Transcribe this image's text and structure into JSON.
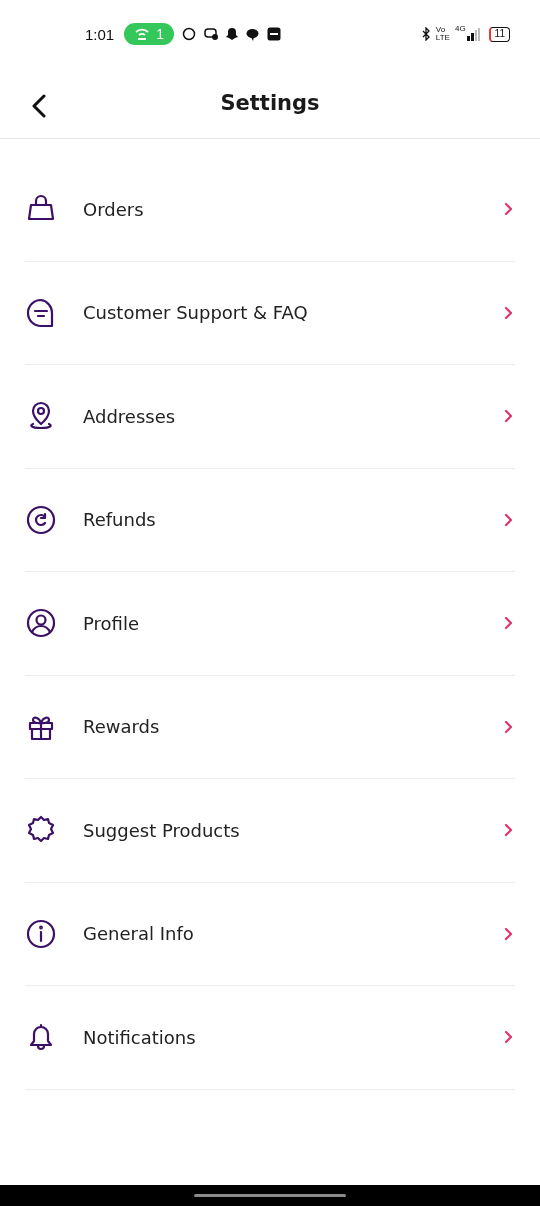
{
  "status_bar": {
    "time": "1:01",
    "hotspot_count": "1",
    "volte": [
      "Vo",
      "LTE"
    ],
    "network": "4G",
    "battery": "11"
  },
  "header": {
    "title": "Settings"
  },
  "items": [
    {
      "label": "Orders",
      "kind": "bag"
    },
    {
      "label": "Customer Support & FAQ",
      "kind": "chat"
    },
    {
      "label": "Addresses",
      "kind": "pin"
    },
    {
      "label": "Refunds",
      "kind": "refund"
    },
    {
      "label": "Profile",
      "kind": "user"
    },
    {
      "label": "Rewards",
      "kind": "gift"
    },
    {
      "label": "Suggest Products",
      "kind": "badge"
    },
    {
      "label": "General Info",
      "kind": "info"
    },
    {
      "label": "Notifications",
      "kind": "bell"
    }
  ]
}
